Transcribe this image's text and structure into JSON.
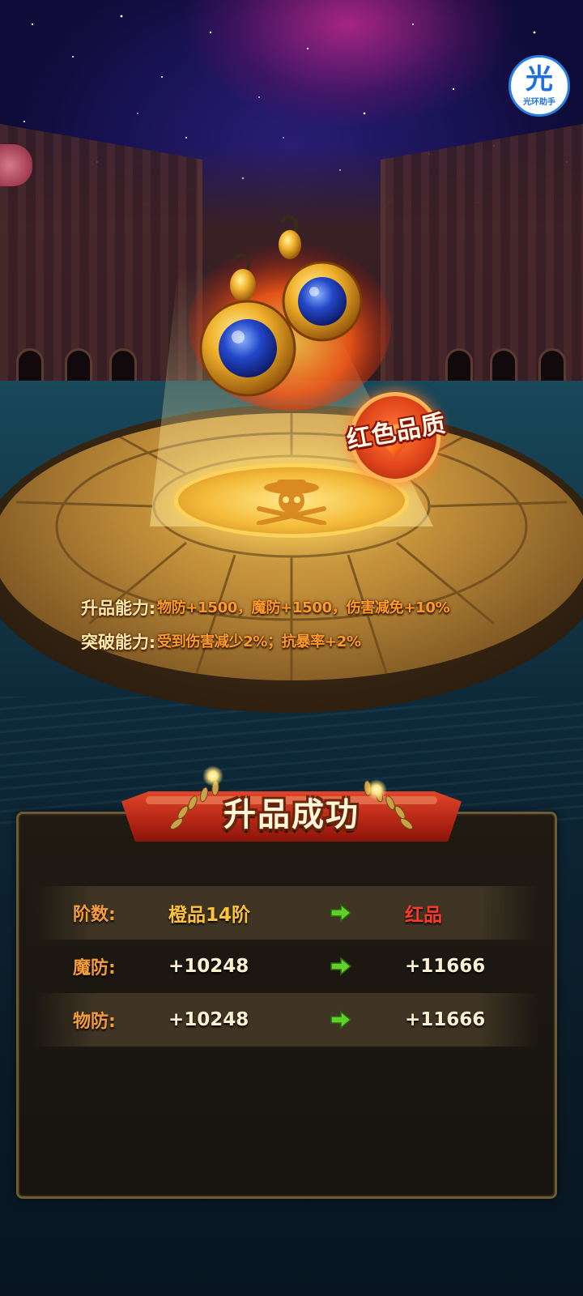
{
  "watermark": {
    "glyph": "光",
    "text": "光环助手"
  },
  "item": {
    "quality_badge": "红色品质"
  },
  "abilities": [
    {
      "label": "升品能力",
      "value": "物防+1500，魔防+1500，伤害减免+10%"
    },
    {
      "label": "突破能力",
      "value": "受到伤害减少2%；抗暴率+2%"
    }
  ],
  "result": {
    "title": "升品成功",
    "rows": [
      {
        "label": "阶数:",
        "from": "橙品14阶",
        "to": "红品"
      },
      {
        "label": "魔防:",
        "from": "+10248",
        "to": "+11666"
      },
      {
        "label": "物防:",
        "from": "+10248",
        "to": "+11666"
      }
    ]
  },
  "colors": {
    "label_orange": "#f79c3a",
    "value_orange": "#ff9a2a",
    "quality_red": "#ff3a2a",
    "arrow_green": "#5fd12a"
  }
}
